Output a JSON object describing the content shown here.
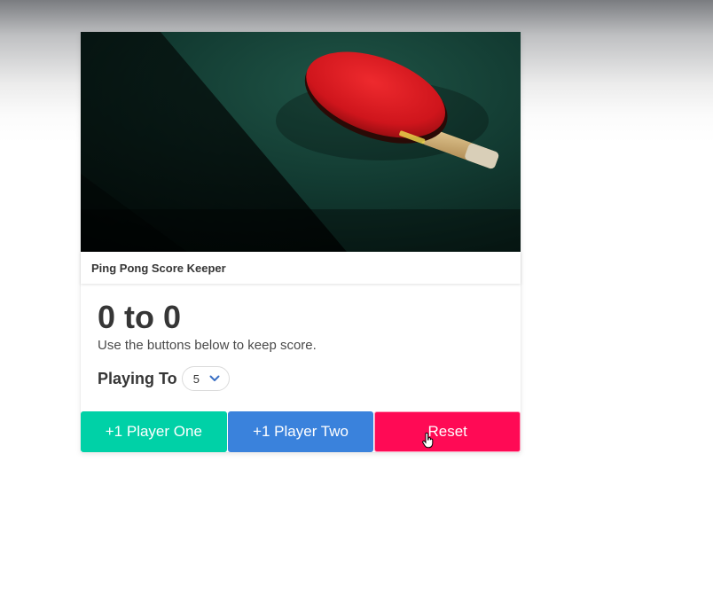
{
  "card": {
    "image": {
      "icon": "ping-pong-paddle-photo",
      "colors": {
        "table": "#0f3a30",
        "paddle": "#d81a22",
        "handle": "#c9a86a"
      }
    },
    "header": {
      "title": "Ping Pong Score Keeper"
    },
    "content": {
      "score": "0 to 0",
      "subtitle": "Use the buttons below to keep score.",
      "playing_to_label": "Playing To",
      "playing_to_value": "5"
    },
    "footer": {
      "player_one_label": "+1 Player One",
      "player_two_label": "+1 Player Two",
      "reset_label": "Reset"
    }
  },
  "colors": {
    "player_one": "#00d1a7",
    "player_two": "#3a82dc",
    "reset": "#ff0a55"
  }
}
